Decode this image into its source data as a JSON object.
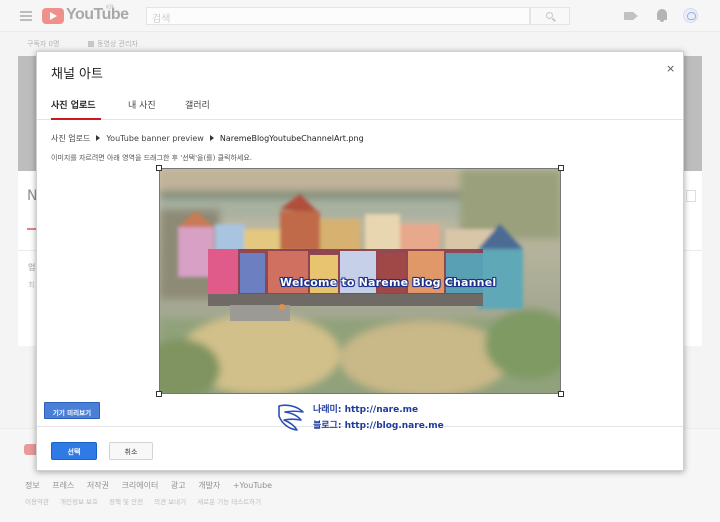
{
  "topbar": {
    "logo_text": "YouTube",
    "region": "KR",
    "search_placeholder": "검색"
  },
  "background_page": {
    "subscribers": "구독자 0명",
    "video_manager": "동영상 관리자",
    "channel_initial": "N",
    "section_text_1": "업",
    "section_text_2": "최"
  },
  "dialog": {
    "title": "채널 아트",
    "close_label": "×",
    "tabs": [
      {
        "label": "사진 업로드",
        "active": true
      },
      {
        "label": "내 사진",
        "active": false
      },
      {
        "label": "갤러리",
        "active": false
      }
    ],
    "breadcrumb": [
      "사진 업로드",
      "YouTube banner preview",
      "NaremeBlogYoutubeChannelArt.png"
    ],
    "hint": "이미지를 자르려면 아래 영역을 드래그한 후 '선택'을(를) 클릭하세요.",
    "banner_text": "Welcome to Nareme Blog Channel",
    "preview_button": "기기 미리보기",
    "select_button": "선택",
    "cancel_button": "취소"
  },
  "watermark": {
    "line1": "나래미: http://nare.me",
    "line2": "블로그: http://blog.nare.me"
  },
  "footer": {
    "links_primary": [
      "정보",
      "프레스",
      "저작권",
      "크리에이터",
      "광고",
      "개발자",
      "+YouTube"
    ],
    "links_secondary": [
      "이용약관",
      "개인정보 보호",
      "정책 및 안전",
      "의견 보내기",
      "새로운 기능 테스트하기"
    ]
  },
  "colors": {
    "accent_red": "#cc181e",
    "primary_blue": "#2f7ae5",
    "watermark_blue": "#1d3b9e"
  }
}
